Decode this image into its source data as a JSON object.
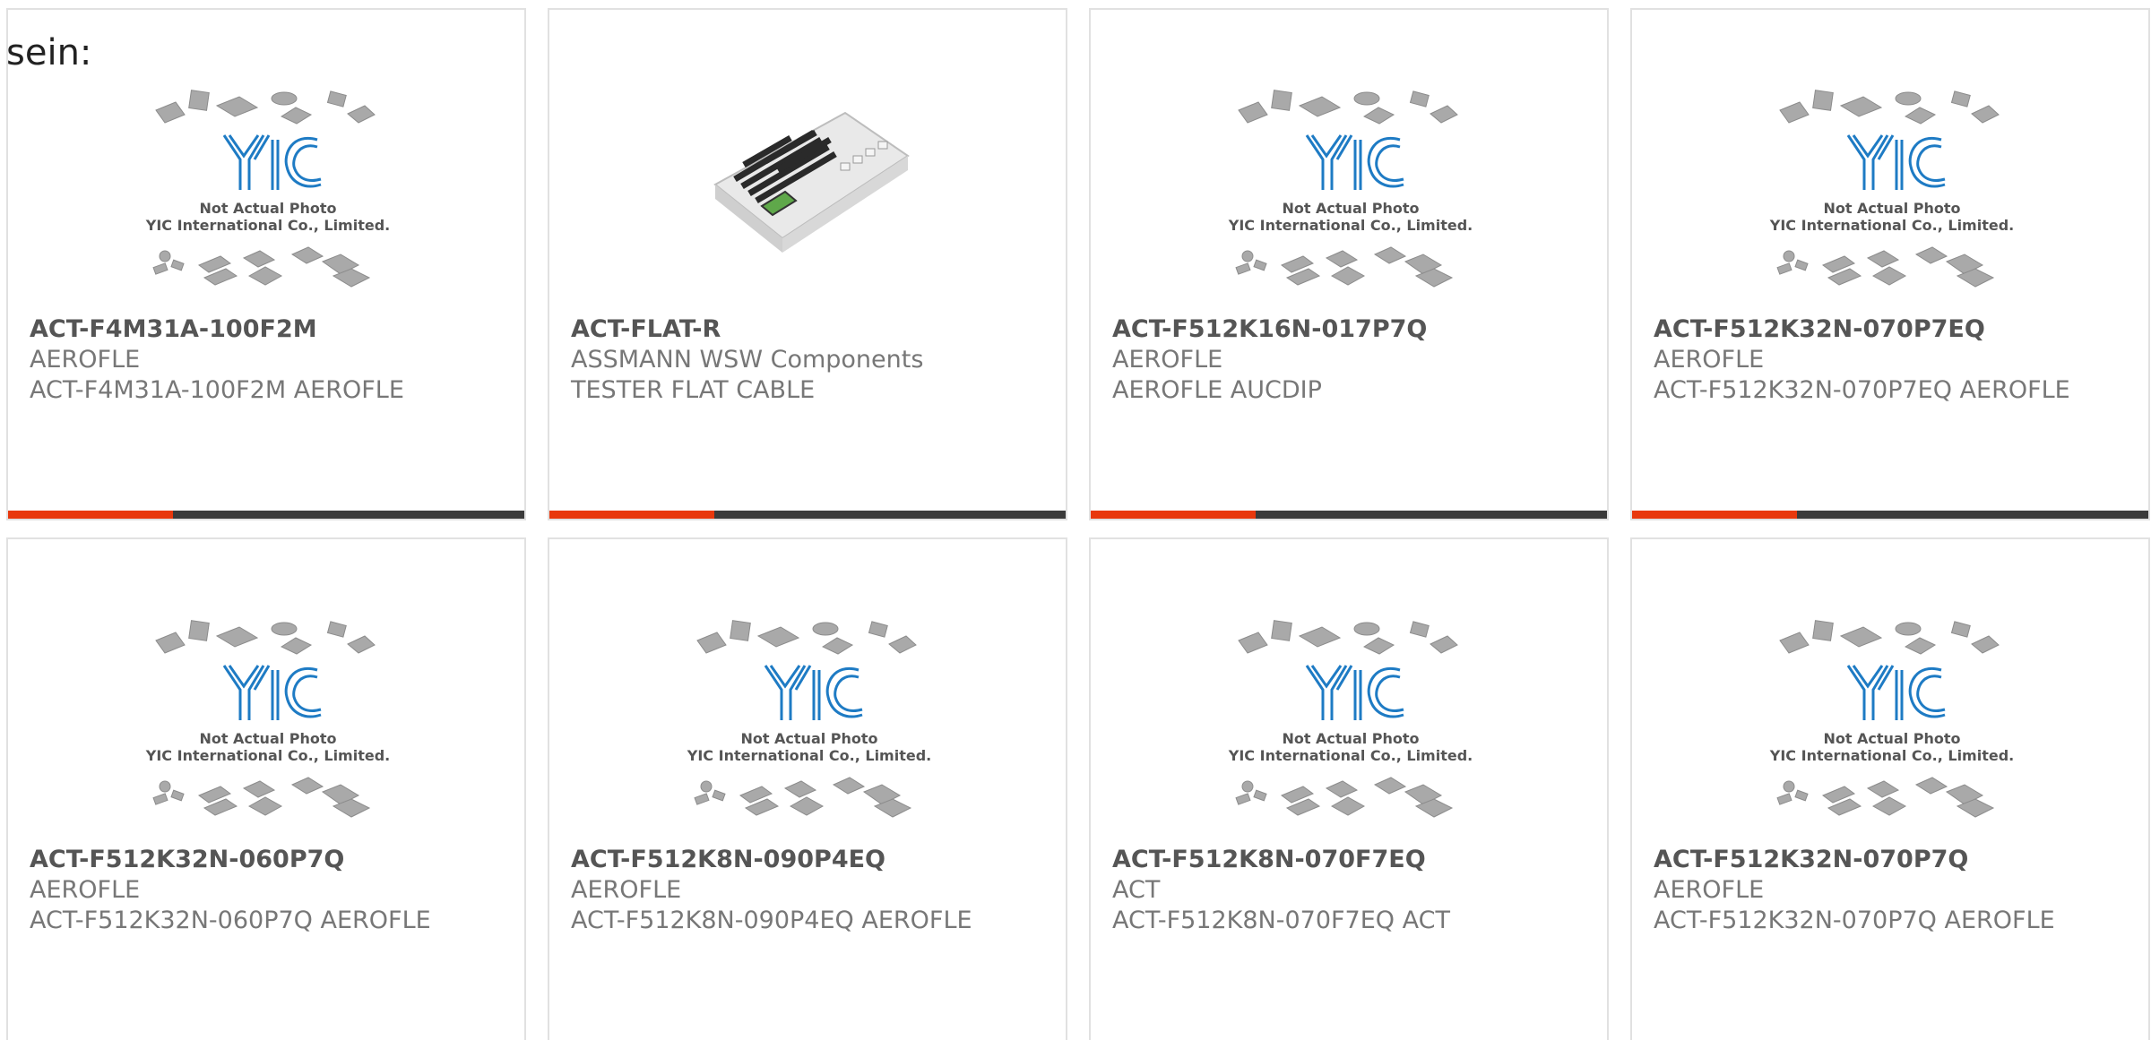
{
  "leading_text": "sein:",
  "colors": {
    "accent": "#e8380d",
    "bar": "#3a3a3a",
    "logo_blue": "#1e7bc4",
    "card_border": "#e1e1e1"
  },
  "placeholder": {
    "line1": "Not Actual Photo",
    "line2": "YIC International Co., Limited."
  },
  "products": [
    {
      "part": "ACT-F4M31A-100F2M",
      "manufacturer": "AEROFLE",
      "description": "ACT-F4M31A-100F2M AEROFLE",
      "image": "yic-placeholder",
      "show_bar": true
    },
    {
      "part": "ACT-FLAT-R",
      "manufacturer": "ASSMANN WSW Components",
      "description": "TESTER FLAT CABLE",
      "image": "cable-tester-photo",
      "show_bar": true
    },
    {
      "part": "ACT-F512K16N-017P7Q",
      "manufacturer": "AEROFLE",
      "description": "AEROFLE AUCDIP",
      "image": "yic-placeholder",
      "show_bar": true
    },
    {
      "part": "ACT-F512K32N-070P7EQ",
      "manufacturer": "AEROFLE",
      "description": "ACT-F512K32N-070P7EQ AEROFLE",
      "image": "yic-placeholder",
      "show_bar": true
    },
    {
      "part": "ACT-F512K32N-060P7Q",
      "manufacturer": "AEROFLE",
      "description": "ACT-F512K32N-060P7Q AEROFLE",
      "image": "yic-placeholder",
      "show_bar": false
    },
    {
      "part": "ACT-F512K8N-090P4EQ",
      "manufacturer": "AEROFLE",
      "description": "ACT-F512K8N-090P4EQ AEROFLE",
      "image": "yic-placeholder",
      "show_bar": false
    },
    {
      "part": "ACT-F512K8N-070F7EQ",
      "manufacturer": "ACT",
      "description": "ACT-F512K8N-070F7EQ ACT",
      "image": "yic-placeholder",
      "show_bar": false
    },
    {
      "part": "ACT-F512K32N-070P7Q",
      "manufacturer": "AEROFLE",
      "description": "ACT-F512K32N-070P7Q AEROFLE",
      "image": "yic-placeholder",
      "show_bar": false
    }
  ]
}
